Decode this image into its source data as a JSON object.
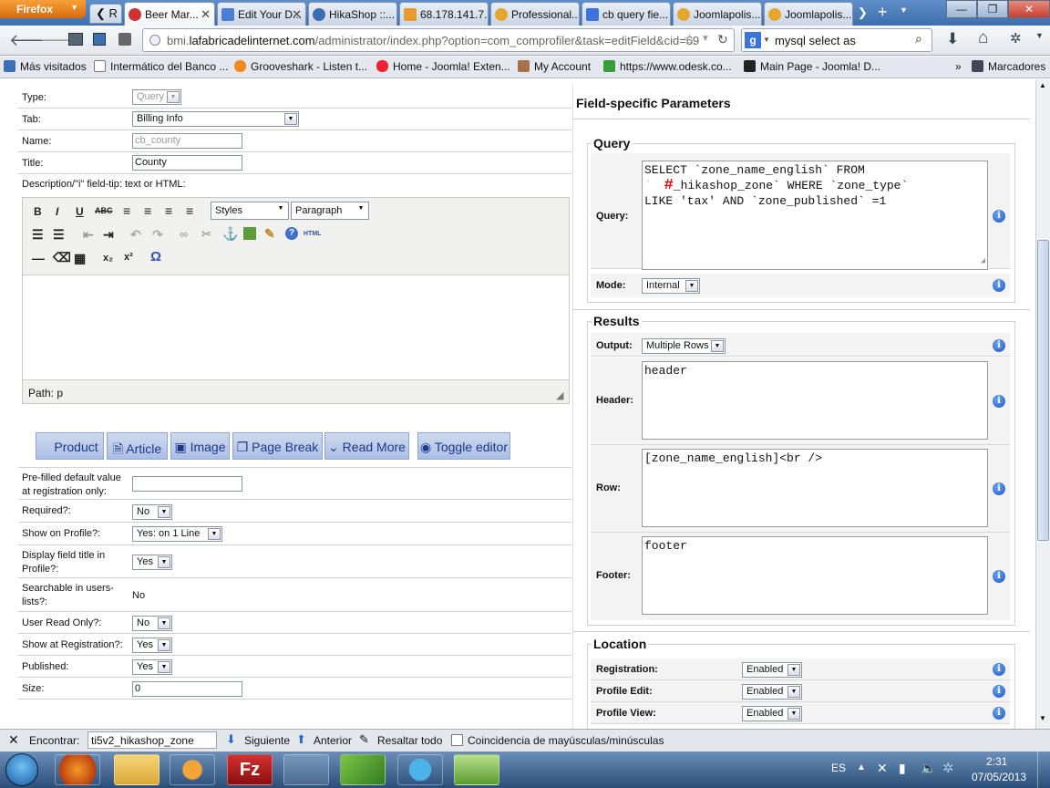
{
  "browser": {
    "menu_label": "Firefox",
    "tabs": [
      {
        "label": "Beer Mar..."
      },
      {
        "label": "Edit Your D..."
      },
      {
        "label": "HikaShop ::..."
      },
      {
        "label": "68.178.141.7..."
      },
      {
        "label": "Professional..."
      },
      {
        "label": "cb query fie..."
      },
      {
        "label": "Joomlapolis..."
      },
      {
        "label": "Joomlapolis..."
      }
    ],
    "url_prefix": "bmi.",
    "url_domain": "lafabricadelinternet.com",
    "url_rest": "/administrator/index.php?option=com_comprofiler&task=editField&cid=69",
    "search_text": "mysql select as",
    "bookmarks": [
      "Más visitados",
      "Intermático del Banco ...",
      "Grooveshark - Listen t...",
      "Home - Joomla! Exten...",
      "My Account",
      "https://www.odesk.co...",
      "Main Page - Joomla! D..."
    ],
    "bookmarks_menu": "Marcadores"
  },
  "form": {
    "type_label": "Type:",
    "type_value": "Query",
    "tab_label": "Tab:",
    "tab_value": "Billing Info",
    "name_label": "Name:",
    "name_value": "cb_county",
    "title_label": "Title:",
    "title_value": "County",
    "desc_label": "Description/\"i\" field-tip: text or HTML:",
    "styles_value": "Styles",
    "format_value": "Paragraph",
    "path_label": "Path: p",
    "buttons": [
      "Product",
      "Article",
      "Image",
      "Page Break",
      "Read More",
      "Toggle editor"
    ],
    "prefilled_label": "Pre-filled default value at registration only:",
    "required_label": "Required?:",
    "required_value": "No",
    "showprofile_label": "Show on Profile?:",
    "showprofile_value": "Yes: on 1 Line",
    "displaytitle_label": "Display field title in Profile?:",
    "displaytitle_value": "Yes",
    "searchable_label": "Searchable in users-lists?:",
    "searchable_value": "No",
    "readonly_label": "User Read Only?:",
    "readonly_value": "No",
    "showreg_label": "Show at Registration?:",
    "showreg_value": "Yes",
    "published_label": "Published:",
    "published_value": "Yes",
    "size_label": "Size:",
    "size_value": "0"
  },
  "params": {
    "title": "Field-specific Parameters",
    "query_legend": "Query",
    "query_label": "Query:",
    "query_text_1": "SELECT `zone_name_english` FROM",
    "query_text_2a": "`",
    "query_text_2b": "#",
    "query_text_2c": "_hikashop_zone` WHERE `zone_type`",
    "query_text_3": "LIKE 'tax' AND `zone_published` =1",
    "mode_label": "Mode:",
    "mode_value": "Internal",
    "results_legend": "Results",
    "output_label": "Output:",
    "output_value": "Multiple Rows",
    "header_label": "Header:",
    "header_text": "header",
    "row_label": "Row:",
    "row_text": "[zone_name_english]<br />",
    "footer_label": "Footer:",
    "footer_text": "footer",
    "location_legend": "Location",
    "registration_label": "Registration:",
    "registration_value": "Enabled",
    "profileedit_label": "Profile Edit:",
    "profileedit_value": "Enabled",
    "profileview_label": "Profile View:",
    "profileview_value": "Enabled"
  },
  "findbar": {
    "label": "Encontrar:",
    "value": "ti5v2_hikashop_zone",
    "next": "Siguiente",
    "prev": "Anterior",
    "highlight": "Resaltar todo",
    "matchcase": "Coincidencia de mayúsculas/minúsculas"
  },
  "taskbar": {
    "lang": "ES",
    "time": "2:31",
    "date": "07/05/2013"
  }
}
